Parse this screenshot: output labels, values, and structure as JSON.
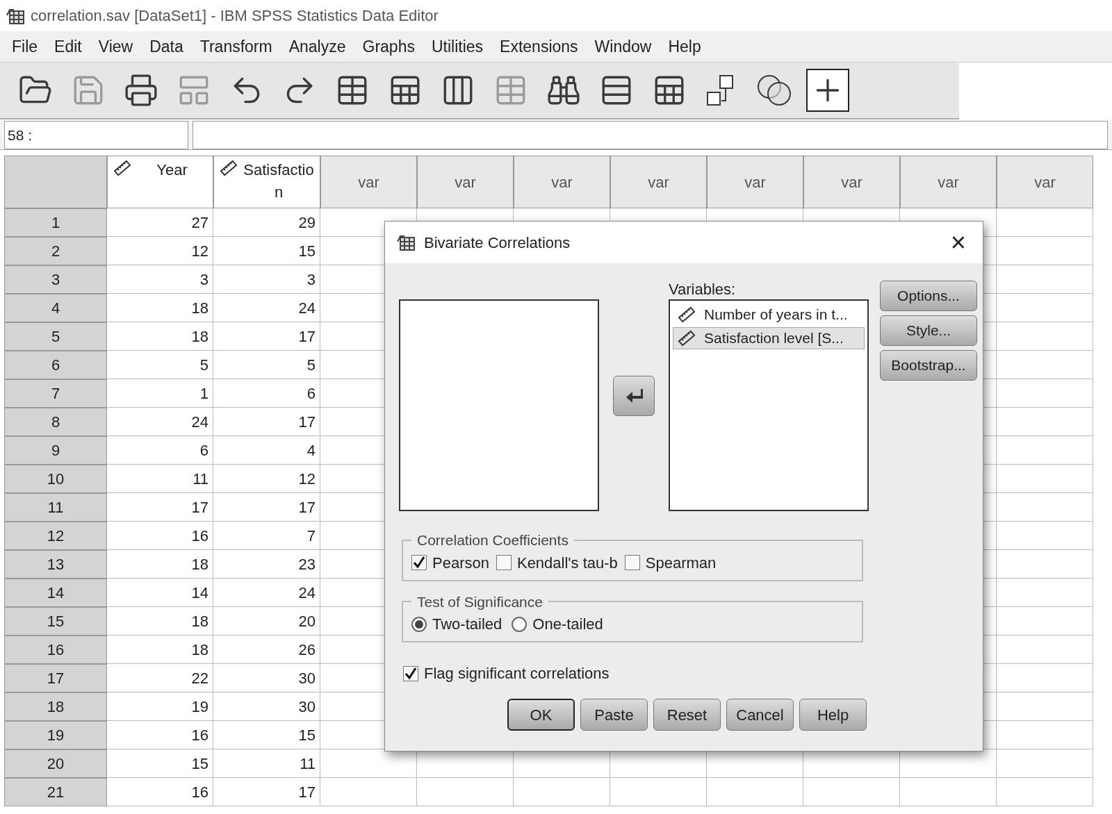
{
  "window": {
    "title": "correlation.sav [DataSet1] - IBM SPSS Statistics Data Editor"
  },
  "menu": [
    "File",
    "Edit",
    "View",
    "Data",
    "Transform",
    "Analyze",
    "Graphs",
    "Utilities",
    "Extensions",
    "Window",
    "Help"
  ],
  "toolbar": [
    {
      "disabled": false,
      "pressed": false
    },
    {
      "disabled": true,
      "pressed": false
    },
    {
      "disabled": false,
      "pressed": false
    },
    {
      "disabled": true,
      "pressed": false
    },
    {
      "disabled": false,
      "pressed": false
    },
    {
      "disabled": false,
      "pressed": false
    },
    {
      "disabled": false,
      "pressed": false
    },
    {
      "disabled": false,
      "pressed": false
    },
    {
      "disabled": false,
      "pressed": false
    },
    {
      "disabled": true,
      "pressed": false
    },
    {
      "disabled": false,
      "pressed": false
    },
    {
      "disabled": false,
      "pressed": false
    },
    {
      "disabled": false,
      "pressed": false
    },
    {
      "disabled": false,
      "pressed": false
    },
    {
      "disabled": false,
      "pressed": false
    },
    {
      "disabled": false,
      "pressed": true
    }
  ],
  "cell_ref": "58 :",
  "grid": {
    "columns": [
      {
        "name": "Year",
        "kind": "scale"
      },
      {
        "name": "Satisfaction",
        "kind": "scale"
      },
      {
        "name": "var",
        "kind": "empty"
      },
      {
        "name": "var",
        "kind": "empty"
      },
      {
        "name": "var",
        "kind": "empty"
      },
      {
        "name": "var",
        "kind": "empty"
      },
      {
        "name": "var",
        "kind": "empty"
      },
      {
        "name": "var",
        "kind": "empty"
      },
      {
        "name": "var",
        "kind": "empty"
      },
      {
        "name": "var",
        "kind": "empty"
      }
    ],
    "rows": [
      {
        "num": "1",
        "values": [
          "27",
          "29"
        ]
      },
      {
        "num": "2",
        "values": [
          "12",
          "15"
        ]
      },
      {
        "num": "3",
        "values": [
          "3",
          "3"
        ]
      },
      {
        "num": "4",
        "values": [
          "18",
          "24"
        ]
      },
      {
        "num": "5",
        "values": [
          "18",
          "17"
        ]
      },
      {
        "num": "6",
        "values": [
          "5",
          "5"
        ]
      },
      {
        "num": "7",
        "values": [
          "1",
          "6"
        ]
      },
      {
        "num": "8",
        "values": [
          "24",
          "17"
        ]
      },
      {
        "num": "9",
        "values": [
          "6",
          "4"
        ]
      },
      {
        "num": "10",
        "values": [
          "11",
          "12"
        ]
      },
      {
        "num": "11",
        "values": [
          "17",
          "17"
        ]
      },
      {
        "num": "12",
        "values": [
          "16",
          "7"
        ]
      },
      {
        "num": "13",
        "values": [
          "18",
          "23"
        ]
      },
      {
        "num": "14",
        "values": [
          "14",
          "24"
        ]
      },
      {
        "num": "15",
        "values": [
          "18",
          "20"
        ]
      },
      {
        "num": "16",
        "values": [
          "18",
          "26"
        ]
      },
      {
        "num": "17",
        "values": [
          "22",
          "30"
        ]
      },
      {
        "num": "18",
        "values": [
          "19",
          "30"
        ]
      },
      {
        "num": "19",
        "values": [
          "16",
          "15"
        ]
      },
      {
        "num": "20",
        "values": [
          "15",
          "11"
        ]
      },
      {
        "num": "21",
        "values": [
          "16",
          "17"
        ]
      }
    ]
  },
  "dialog": {
    "title": "Bivariate Correlations",
    "close": "×",
    "variables_label": "Variables:",
    "variables": [
      {
        "label": "Number of years in t...",
        "selected": false
      },
      {
        "label": "Satisfaction level [S...",
        "selected": true
      }
    ],
    "side_buttons": [
      "Options...",
      "Style...",
      "Bootstrap..."
    ],
    "coefficients": {
      "title": "Correlation Coefficients",
      "options": [
        {
          "label": "Pearson",
          "checked": true
        },
        {
          "label": "Kendall's tau-b",
          "checked": false
        },
        {
          "label": "Spearman",
          "checked": false
        }
      ]
    },
    "significance": {
      "title": "Test of Significance",
      "options": [
        {
          "label": "Two-tailed",
          "selected": true
        },
        {
          "label": "One-tailed",
          "selected": false
        }
      ]
    },
    "flag": {
      "label": "Flag significant correlations",
      "checked": true
    },
    "buttons": [
      {
        "label": "OK",
        "default": true
      },
      {
        "label": "Paste",
        "default": false
      },
      {
        "label": "Reset",
        "default": false
      },
      {
        "label": "Cancel",
        "default": false
      },
      {
        "label": "Help",
        "default": false
      }
    ]
  }
}
